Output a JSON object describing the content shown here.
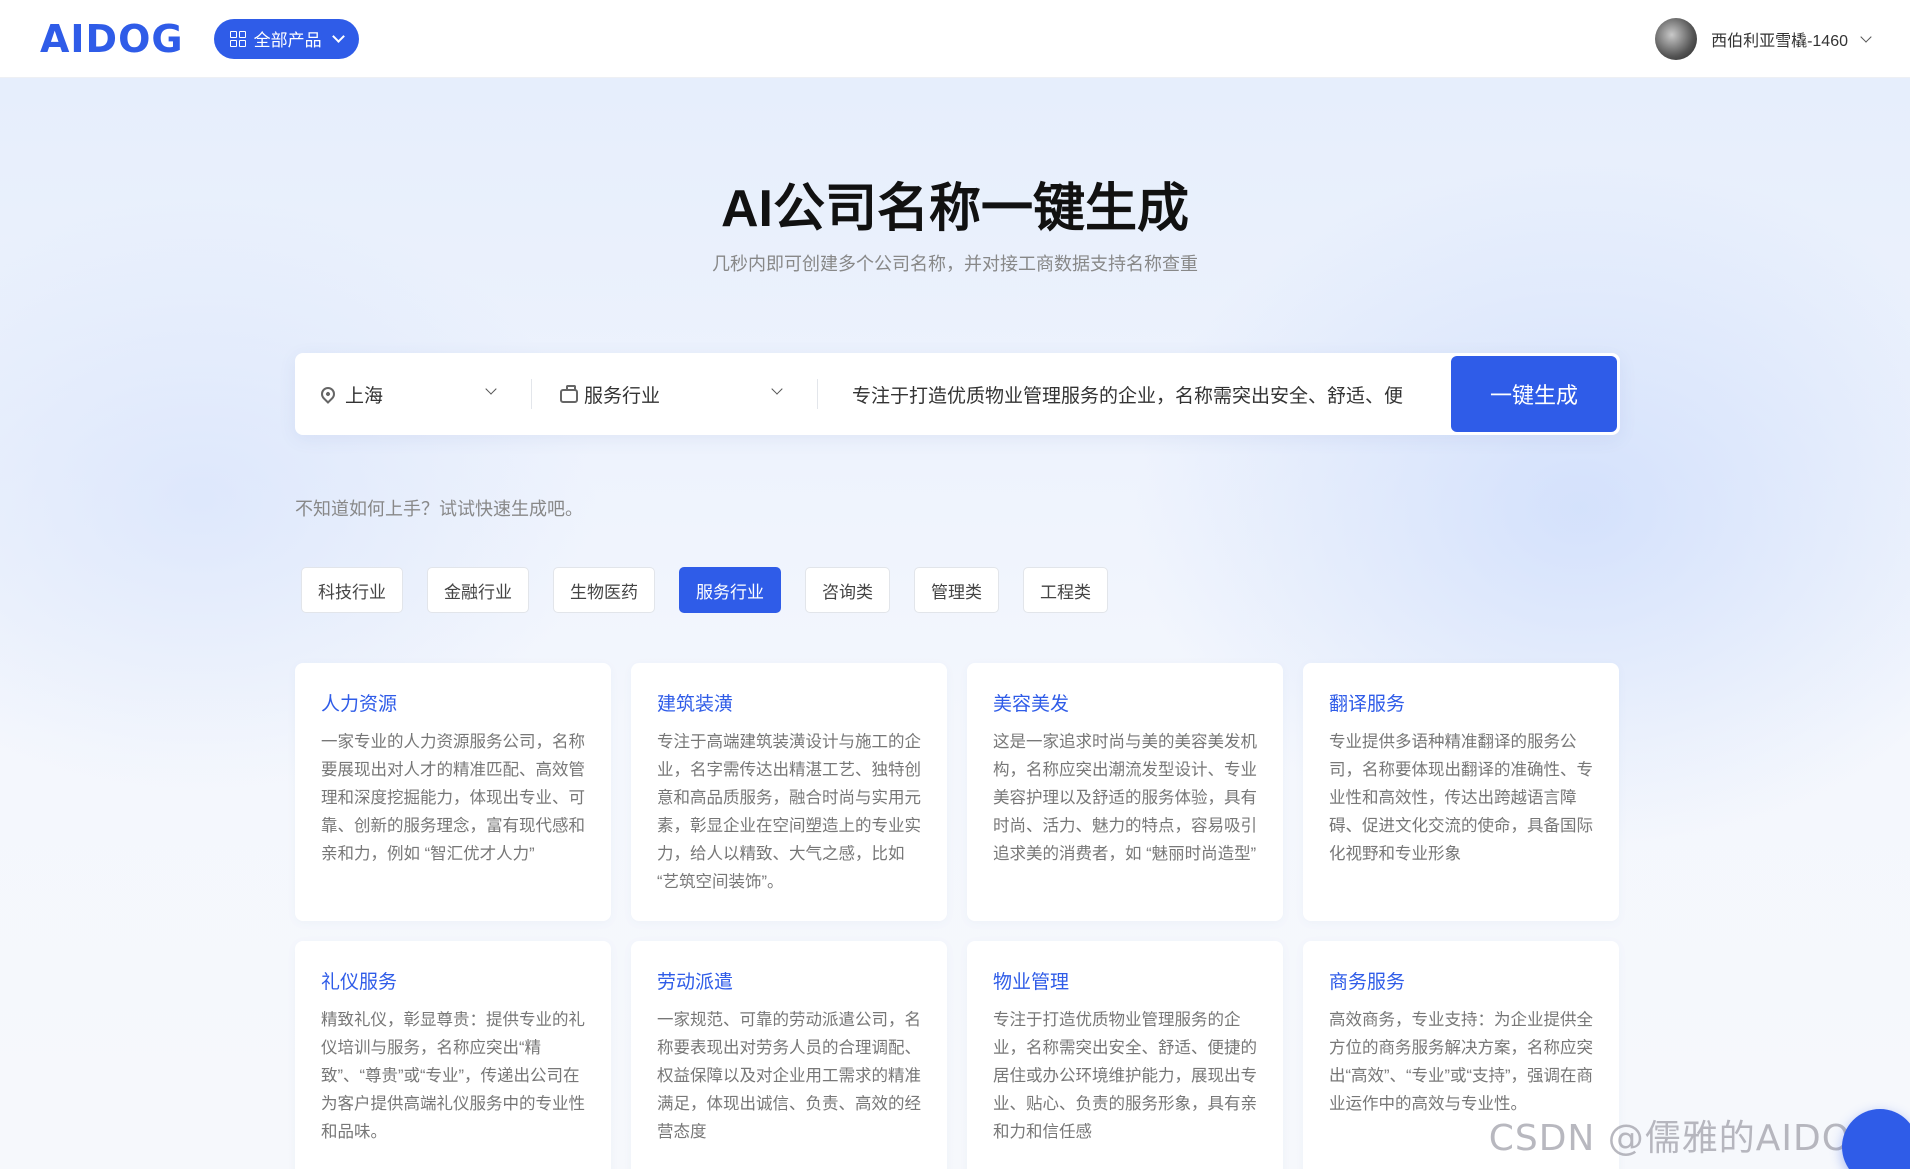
{
  "header": {
    "logo": "AIDOG",
    "products_label": "全部产品",
    "username": "西伯利亚雪橇-1460"
  },
  "hero": {
    "title": "AI公司名称一键生成",
    "subtitle": "几秒内即可创建多个公司名称，并对接工商数据支持名称查重"
  },
  "search": {
    "city": "上海",
    "industry": "服务行业",
    "description": "专注于打造优质物业管理服务的企业，名称需突出安全、舒适、便",
    "generate_label": "一键生成"
  },
  "hint": "不知道如何上手？试试快速生成吧。",
  "tags": [
    {
      "label": "科技行业",
      "active": false
    },
    {
      "label": "金融行业",
      "active": false
    },
    {
      "label": "生物医药",
      "active": false
    },
    {
      "label": "服务行业",
      "active": true
    },
    {
      "label": "咨询类",
      "active": false
    },
    {
      "label": "管理类",
      "active": false
    },
    {
      "label": "工程类",
      "active": false
    }
  ],
  "cards": [
    {
      "title": "人力资源",
      "desc": "一家专业的人力资源服务公司，名称要展现出对人才的精准匹配、高效管理和深度挖掘能力，体现出专业、可靠、创新的服务理念，富有现代感和亲和力，例如 “智汇优才人力”"
    },
    {
      "title": "建筑装潢",
      "desc": "专注于高端建筑装潢设计与施工的企业，名字需传达出精湛工艺、独特创意和高品质服务，融合时尚与实用元素，彰显企业在空间塑造上的专业实力，给人以精致、大气之感，比如 “艺筑空间装饰”。"
    },
    {
      "title": "美容美发",
      "desc": "这是一家追求时尚与美的美容美发机构，名称应突出潮流发型设计、专业美容护理以及舒适的服务体验，具有时尚、活力、魅力的特点，容易吸引追求美的消费者，如 “魅丽时尚造型”"
    },
    {
      "title": "翻译服务",
      "desc": "专业提供多语种精准翻译的服务公司，名称要体现出翻译的准确性、专业性和高效性，传达出跨越语言障碍、促进文化交流的使命，具备国际化视野和专业形象"
    },
    {
      "title": "礼仪服务",
      "desc": "精致礼仪，彰显尊贵：提供专业的礼仪培训与服务，名称应突出“精致”、“尊贵”或“专业”，传递出公司在为客户提供高端礼仪服务中的专业性和品味。"
    },
    {
      "title": "劳动派遣",
      "desc": "一家规范、可靠的劳动派遣公司，名称要表现出对劳务人员的合理调配、权益保障以及对企业用工需求的精准满足，体现出诚信、负责、高效的经营态度"
    },
    {
      "title": "物业管理",
      "desc": "专注于打造优质物业管理服务的企业，名称需突出安全、舒适、便捷的居住或办公环境维护能力，展现出专业、贴心、负责的服务形象，具有亲和力和信任感"
    },
    {
      "title": "商务服务",
      "desc": "高效商务，专业支持：为企业提供全方位的商务服务解决方案，名称应突出“高效”、“专业”或“支持”，强调在商业运作中的高效与专业性。"
    }
  ],
  "watermark": "CSDN @儒雅的AIDOG"
}
